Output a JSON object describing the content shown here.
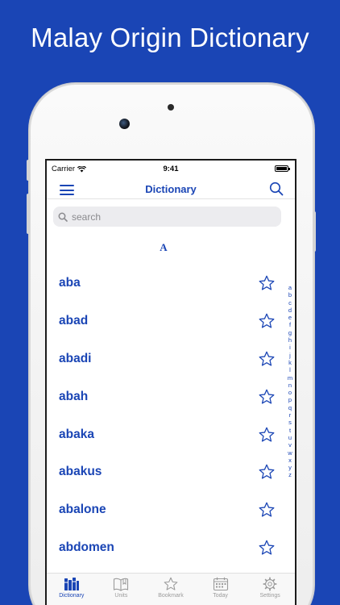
{
  "banner_title": "Malay Origin Dictionary",
  "status": {
    "carrier": "Carrier",
    "time": "9:41"
  },
  "nav": {
    "title": "Dictionary"
  },
  "search": {
    "placeholder": "search"
  },
  "section_header": "A",
  "words": [
    "aba",
    "abad",
    "abadi",
    "abah",
    "abaka",
    "abakus",
    "abalone",
    "abdomen"
  ],
  "index_letters": [
    "a",
    "b",
    "c",
    "d",
    "e",
    "f",
    "g",
    "h",
    "i",
    "j",
    "k",
    "l",
    "m",
    "n",
    "o",
    "p",
    "q",
    "r",
    "s",
    "t",
    "u",
    "v",
    "w",
    "x",
    "y",
    "z"
  ],
  "tabs": [
    {
      "label": "Dictionary",
      "icon": "books-icon",
      "active": true
    },
    {
      "label": "Units",
      "icon": "open-book-icon",
      "active": false
    },
    {
      "label": "Bookmark",
      "icon": "star-icon",
      "active": false
    },
    {
      "label": "Today",
      "icon": "calendar-icon",
      "active": false
    },
    {
      "label": "Settings",
      "icon": "gear-icon",
      "active": false
    }
  ],
  "colors": {
    "accent": "#1a45b5",
    "background": "#1a45b5",
    "inactive": "#9b9b9b"
  }
}
